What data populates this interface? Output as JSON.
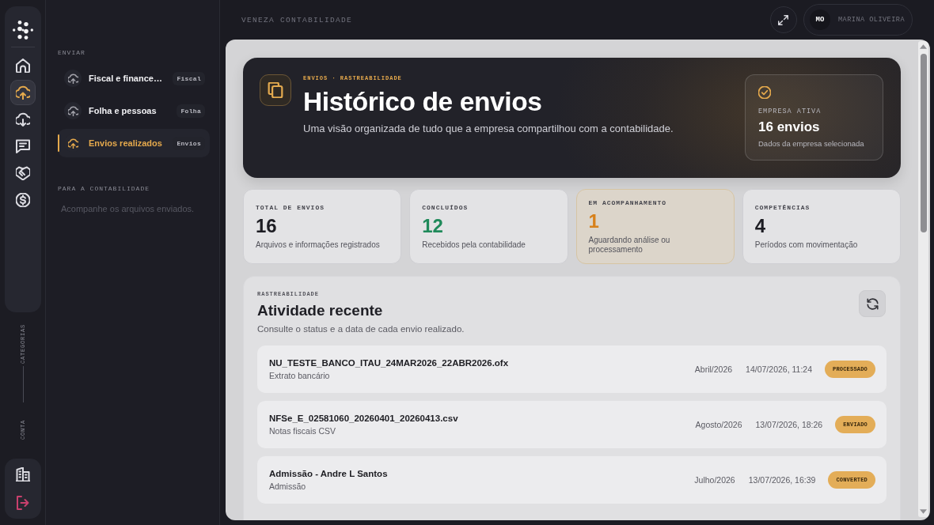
{
  "rail": {
    "nav_items": [
      {
        "kind": "home",
        "selected": false
      },
      {
        "kind": "upload",
        "selected": true
      },
      {
        "kind": "download",
        "selected": false
      },
      {
        "kind": "messages",
        "selected": false
      },
      {
        "kind": "partners",
        "selected": false
      },
      {
        "kind": "finance",
        "selected": false
      }
    ],
    "section_labels": [
      "CATEGORIAS",
      "CONTA"
    ],
    "account_items": [
      {
        "kind": "company"
      },
      {
        "kind": "logout"
      }
    ]
  },
  "sidebar": {
    "sections": [
      {
        "title": "ENVIAR",
        "items": [
          {
            "label": "Fiscal e finance…",
            "badge": "Fiscal",
            "selected": false
          },
          {
            "label": "Folha e pessoas",
            "badge": "Folha",
            "selected": false
          },
          {
            "label": "Envios realizados",
            "badge": "Envios",
            "selected": true
          }
        ]
      },
      {
        "title": "PARA A CONTABILIDADE",
        "note": "Acompanhe os arquivos enviados."
      }
    ]
  },
  "topbar": {
    "company": "VENEZA CONTABILIDADE",
    "user": {
      "initials": "MO",
      "name": "MARINA OLIVEIRA"
    }
  },
  "hero": {
    "eyebrow": "ENVIOS · RASTREABILIDADE",
    "title": "Histórico de envios",
    "subtitle": "Uma visão organizada de tudo que a empresa compartilhou com a contabilidade.",
    "summary": {
      "label": "EMPRESA ATIVA",
      "value": "16 envios",
      "note": "Dados da empresa selecionada"
    }
  },
  "stats": [
    {
      "kind": "neutral",
      "label": "TOTAL DE ENVIOS",
      "value": "16",
      "note": "Arquivos e informações registrados"
    },
    {
      "kind": "success",
      "label": "CONCLUÍDOS",
      "value": "12",
      "note": "Recebidos pela contabilidade"
    },
    {
      "kind": "attention",
      "label": "EM ACOMPANHAMENTO",
      "value": "1",
      "note": "Aguardando análise ou processamento"
    },
    {
      "kind": "neutral",
      "label": "COMPETÊNCIAS",
      "value": "4",
      "note": "Períodos com movimentação"
    }
  ],
  "activity": {
    "eyebrow": "RASTREABILIDADE",
    "title": "Atividade recente",
    "subtitle": "Consulte o status e a data de cada envio realizado.",
    "rows": [
      {
        "name": "NU_TESTE_BANCO_ITAU_24MAR2026_22ABR2026.ofx",
        "type": "Extrato bancário",
        "period": "Abril/2026",
        "date": "14/07/2026, 11:24",
        "status": "PROCESSADO"
      },
      {
        "name": "NFSe_E_02581060_20260401_20260413.csv",
        "type": "Notas fiscais CSV",
        "period": "Agosto/2026",
        "date": "13/07/2026, 18:26",
        "status": "ENVIADO"
      },
      {
        "name": "Admissão - Andre L Santos",
        "type": "Admissão",
        "period": "Julho/2026",
        "date": "13/07/2026, 16:39",
        "status": "CONVERTED"
      }
    ]
  }
}
